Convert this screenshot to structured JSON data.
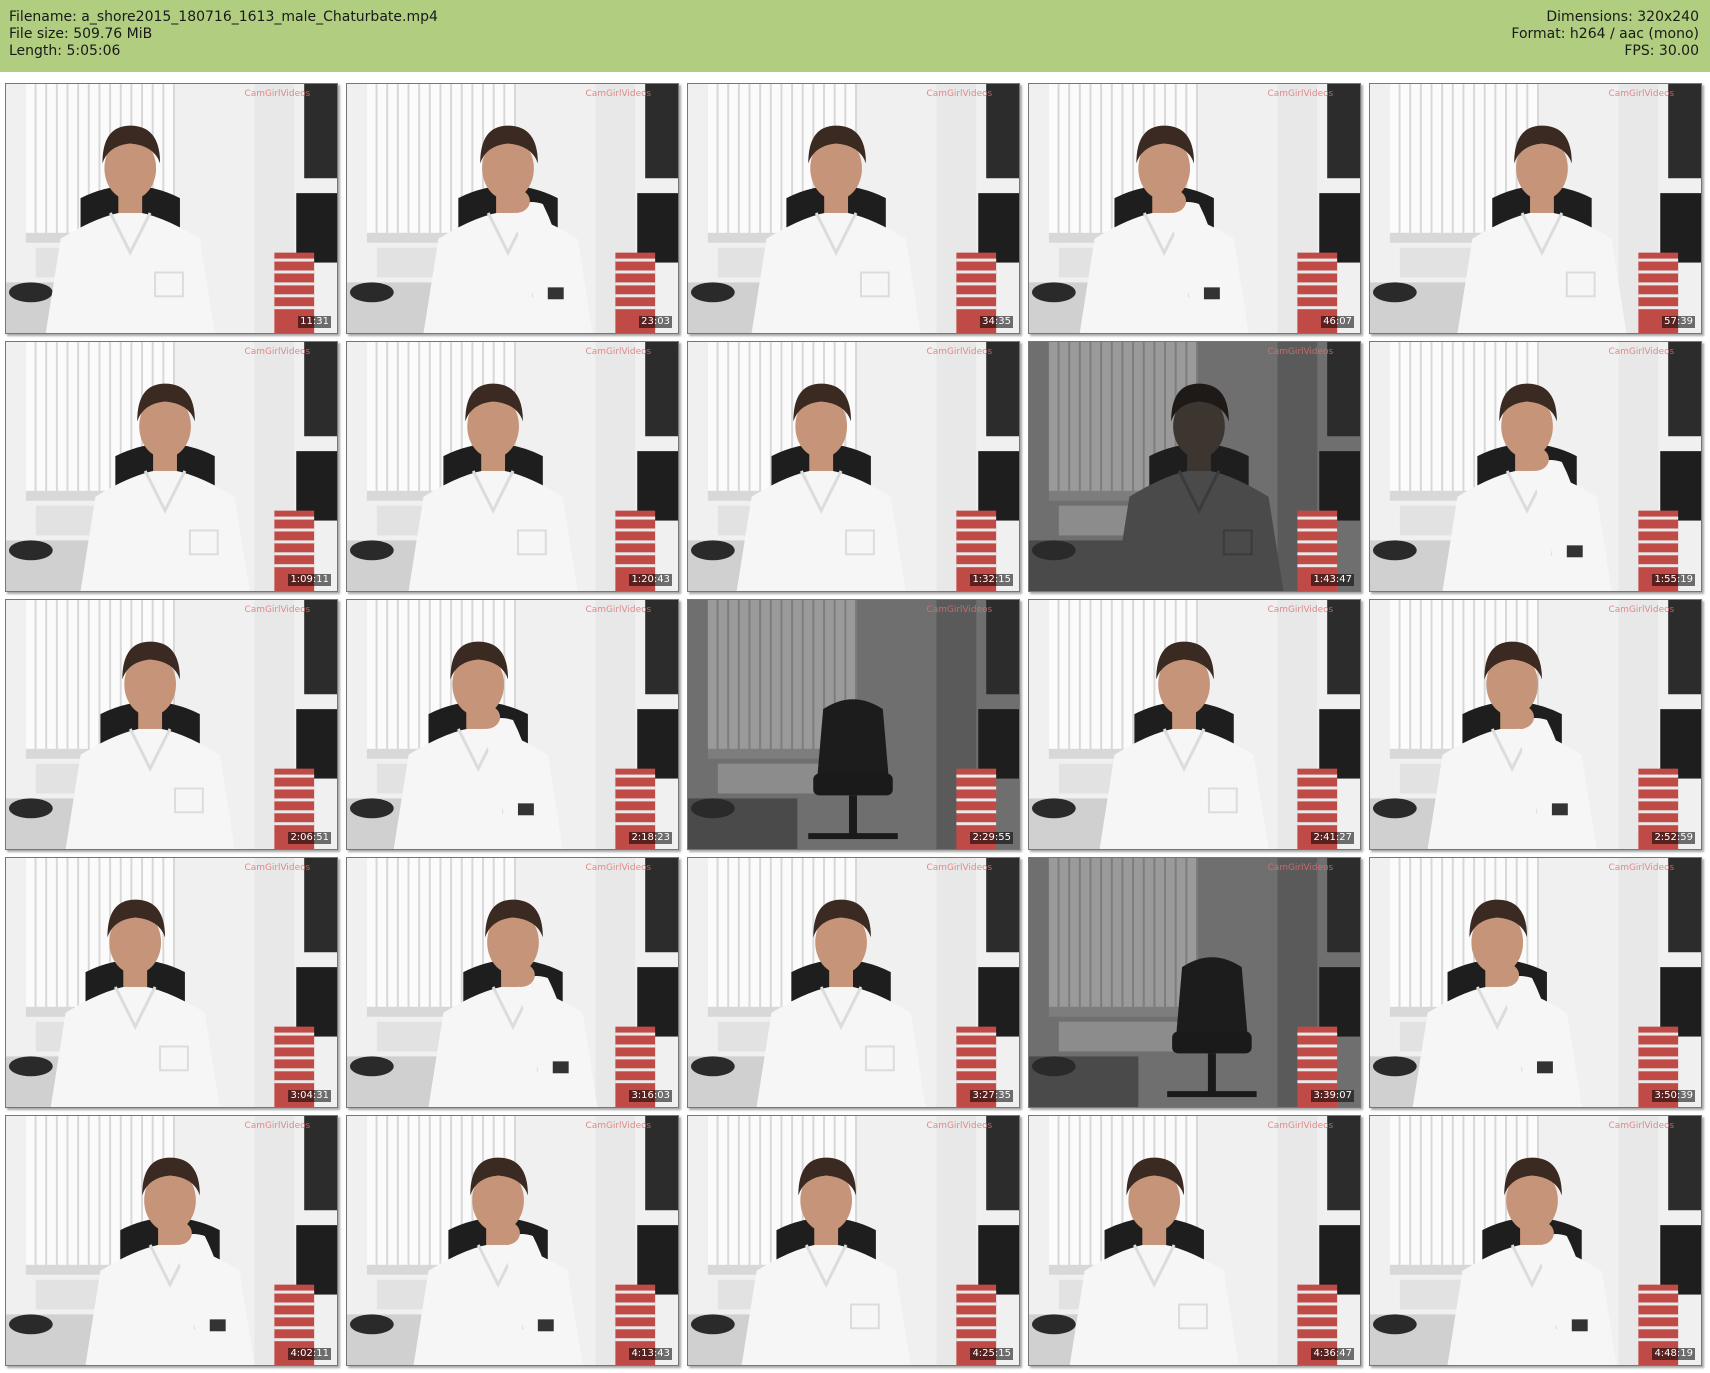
{
  "header": {
    "filename": "Filename: a_shore2015_180716_1613_male_Chaturbate.mp4",
    "file_size": "File size: 509.76 MiB",
    "length": "Length: 5:05:06",
    "dimensions": "Dimensions: 320x240",
    "format": "Format: h264 / aac (mono)",
    "fps": "FPS: 30.00"
  },
  "colors": {
    "header_bg": "#b0cd80",
    "page_bg": "#ffffff"
  },
  "thumbnails": [
    {
      "timestamp": "11:31",
      "scene": "person-hands-down"
    },
    {
      "timestamp": "23:03",
      "scene": "person-hand-on-chin"
    },
    {
      "timestamp": "34:35",
      "scene": "person-hands-down"
    },
    {
      "timestamp": "46:07",
      "scene": "person-hand-on-chin"
    },
    {
      "timestamp": "57:39",
      "scene": "person-hands-down"
    },
    {
      "timestamp": "1:09:11",
      "scene": "person-hands-down"
    },
    {
      "timestamp": "1:20:43",
      "scene": "person-hands-down"
    },
    {
      "timestamp": "1:32:15",
      "scene": "person-hands-down"
    },
    {
      "timestamp": "1:43:47",
      "scene": "dark-person"
    },
    {
      "timestamp": "1:55:19",
      "scene": "person-hand-on-chin"
    },
    {
      "timestamp": "2:06:51",
      "scene": "person-hands-down"
    },
    {
      "timestamp": "2:18:23",
      "scene": "person-hand-on-chin"
    },
    {
      "timestamp": "2:29:55",
      "scene": "empty-chair"
    },
    {
      "timestamp": "2:41:27",
      "scene": "person-hands-down"
    },
    {
      "timestamp": "2:52:59",
      "scene": "person-hand-on-chin"
    },
    {
      "timestamp": "3:04:31",
      "scene": "person-hands-down"
    },
    {
      "timestamp": "3:16:03",
      "scene": "person-hand-on-chin"
    },
    {
      "timestamp": "3:27:35",
      "scene": "person-hands-down"
    },
    {
      "timestamp": "3:39:07",
      "scene": "empty-chair"
    },
    {
      "timestamp": "3:50:39",
      "scene": "person-hand-on-chin"
    },
    {
      "timestamp": "4:02:11",
      "scene": "person-hand-on-chin"
    },
    {
      "timestamp": "4:13:43",
      "scene": "person-hand-on-chin"
    },
    {
      "timestamp": "4:25:15",
      "scene": "person-hands-down"
    },
    {
      "timestamp": "4:36:47",
      "scene": "person-hands-down"
    },
    {
      "timestamp": "4:48:19",
      "scene": "person-hand-on-chin"
    }
  ]
}
